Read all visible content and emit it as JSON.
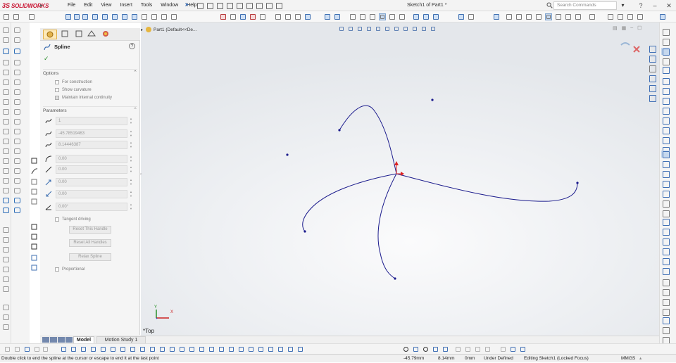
{
  "app": {
    "logo_prefix": "3S",
    "logo_text": "SOLIDWORKS",
    "document_title": "Sketch1 of Part1 *"
  },
  "menu": [
    "File",
    "Edit",
    "View",
    "Insert",
    "Tools",
    "Window",
    "Help"
  ],
  "search": {
    "placeholder": "Search Commands"
  },
  "window_buttons": [
    "–",
    "❐",
    "✕"
  ],
  "feature_tree": {
    "item": "Part1 (Default<<De..."
  },
  "property_manager": {
    "title": "Spline",
    "options": {
      "heading": "Options",
      "for_construction": "For construction",
      "show_curvature": "Show curvature",
      "maintain_internal_continuity": "Maintain internal continuity"
    },
    "parameters": {
      "heading": "Parameters",
      "point_number": "1",
      "x_coordinate": "-45.78519463",
      "y_coordinate": "8.14446387",
      "radius_of_curvature": "0.00",
      "curvature": "0.00",
      "tangent_weight_1": "0.00",
      "tangent_weight_2": "0.00",
      "tangent_angle": "0.00°",
      "tangent_driving": "Tangent driving",
      "reset_this_handle": "Reset This Handle",
      "reset_all_handles": "Reset All Handles",
      "relax_spline": "Relax Spline",
      "proportional": "Proportional"
    }
  },
  "view": {
    "orientation_label": "*Top",
    "triad_x": "X",
    "triad_y": "Y"
  },
  "tabs": {
    "model": "Model",
    "motion_study": "Motion Study 1"
  },
  "status": {
    "message": "Double click to end the spline at the cursor or escape to end it at the last point",
    "x": "-45.79mm",
    "y": "8.14mm",
    "z": "0mm",
    "state": "Under Defined",
    "editing": "Editing Sketch1 (Locked Focus)",
    "units": "MMGS"
  },
  "colors": {
    "brand_red": "#c8102e",
    "sketch_blue": "#1a1a8c",
    "accent_blue": "#3e6fb1"
  }
}
